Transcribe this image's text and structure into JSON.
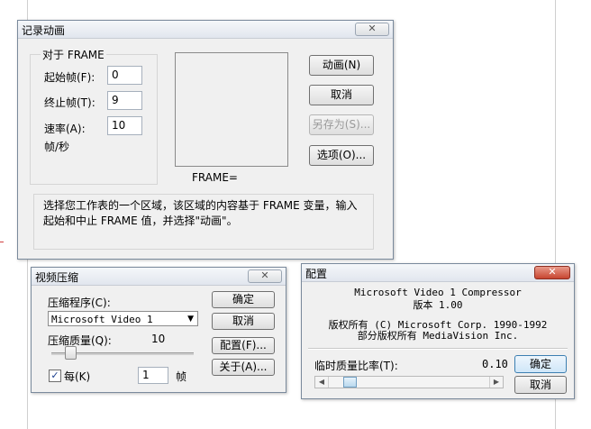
{
  "record_animation": {
    "title": "记录动画",
    "close": "✕",
    "group_title": "对于 FRAME",
    "start_label": "起始帧(F):",
    "start_value": "0",
    "end_label": "终止帧(T):",
    "end_value": "9",
    "rate_label": "速率(A):",
    "rate_value": "10",
    "rate_unit": "帧/秒",
    "frame_label": "FRAME=",
    "buttons": {
      "animate": "动画(N)",
      "cancel": "取消",
      "save_as": "另存为(S)...",
      "options": "选项(O)..."
    },
    "description": "选择您工作表的一个区域，该区域的内容基于 FRAME 变量，输入起始和中止 FRAME 值，并选择\"动画\"。"
  },
  "video_compression": {
    "title": "视频压缩",
    "close": "✕",
    "compressor_label": "压缩程序(C):",
    "compressor_value": "Microsoft Video 1",
    "quality_label": "压缩质量(Q):",
    "quality_value": "10",
    "quality_fraction": 0.1,
    "every_label": "每(K)",
    "every_checked": true,
    "every_value": "1",
    "every_unit": "帧",
    "buttons": {
      "ok": "确定",
      "cancel": "取消",
      "configure": "配置(F)...",
      "about": "关于(A)..."
    }
  },
  "configure": {
    "title": "配置",
    "close": "✕",
    "product": "Microsoft Video 1 Compressor",
    "version": "版本 1.00",
    "copyright1": "版权所有 (C) Microsoft Corp. 1990-1992",
    "copyright2": "部分版权所有 MediaVision Inc.",
    "temporal_label": "临时质量比率(T):",
    "temporal_value": "0.10",
    "temporal_fraction": 0.1,
    "buttons": {
      "ok": "确定",
      "cancel": "取消"
    }
  }
}
